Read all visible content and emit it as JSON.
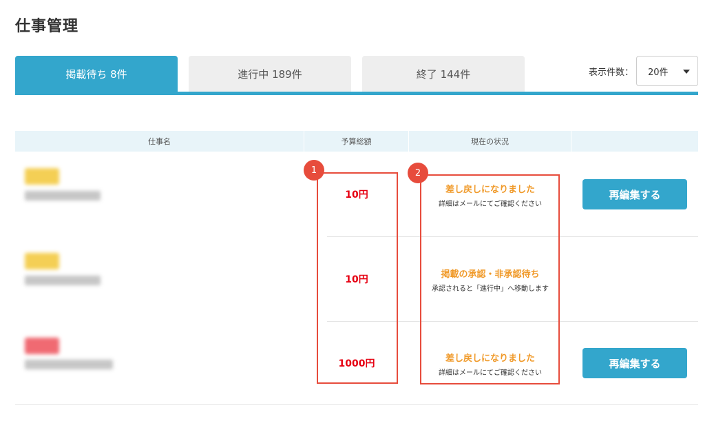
{
  "page": {
    "title": "仕事管理"
  },
  "tabs": [
    {
      "label": "掲載待ち 8件",
      "active": true
    },
    {
      "label": "進行中 189件",
      "active": false
    },
    {
      "label": "終了 144件",
      "active": false
    }
  ],
  "per_page": {
    "label": "表示件数：",
    "value": "20件"
  },
  "table": {
    "headers": [
      "仕事名",
      "予算総額",
      "現在の状況",
      ""
    ],
    "rows": [
      {
        "badge_color": "yellow",
        "budget": "10円",
        "status_title": "差し戻しになりました",
        "status_sub": "詳細はメールにてご確認ください",
        "action": "再編集する"
      },
      {
        "badge_color": "yellow",
        "budget": "10円",
        "status_title": "掲載の承認・非承認待ち",
        "status_sub": "承認されると「進行中」へ移動します",
        "action": ""
      },
      {
        "badge_color": "red",
        "budget": "1000円",
        "status_title": "差し戻しになりました",
        "status_sub": "詳細はメールにてご確認ください",
        "action": "再編集する"
      }
    ]
  },
  "annotations": {
    "marker_1": "1",
    "marker_2": "2"
  },
  "colors": {
    "accent": "#33a6cc",
    "budget": "#e60012",
    "status": "#f09a2a",
    "annotation": "#e74c3c"
  }
}
